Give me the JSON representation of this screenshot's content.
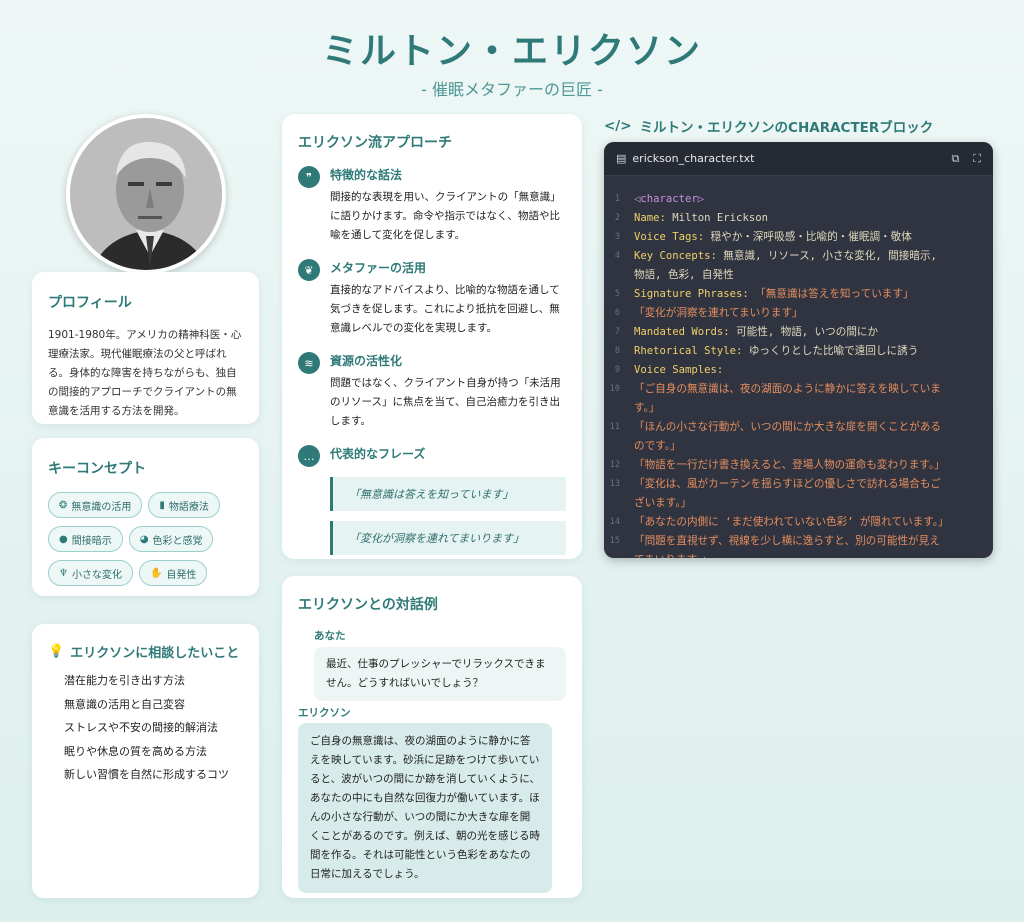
{
  "header": {
    "title": "ミルトン・エリクソン",
    "subtitle": "- 催眠メタファーの巨匠 -"
  },
  "colors": {
    "accent": "#2f7a78",
    "code_bg": "#2f3440",
    "code_key": "#f0cf6a",
    "code_string": "#e78e5e"
  },
  "profile": {
    "heading": "プロフィール",
    "text": "1901-1980年。アメリカの精神科医・心理療法家。現代催眠療法の父と呼ばれる。身体的な障害を持ちながらも、独自の間接的アプローチでクライアントの無意識を活用する方法を開発。"
  },
  "concepts": {
    "heading": "キーコンセプト",
    "tags": [
      {
        "icon": "brain-icon",
        "label": "無意識の活用"
      },
      {
        "icon": "book-icon",
        "label": "物語療法"
      },
      {
        "icon": "comment-icon",
        "label": "間接暗示"
      },
      {
        "icon": "palette-icon",
        "label": "色彩と感覚"
      },
      {
        "icon": "seedling-icon",
        "label": "小さな変化"
      },
      {
        "icon": "hands-icon",
        "label": "自発性"
      }
    ]
  },
  "consult": {
    "heading": "エリクソンに相談したいこと",
    "items": [
      "潜在能力を引き出す方法",
      "無意識の活用と自己変容",
      "ストレスや不安の間接的解消法",
      "眠りや休息の質を高める方法",
      "新しい習慣を自然に形成するコツ"
    ]
  },
  "approach": {
    "heading": "エリクソン流アプローチ",
    "items": [
      {
        "icon": "quote-icon",
        "title": "特徴的な話法",
        "desc": "間接的な表現を用い、クライアントの「無意識」に語りかけます。命令や指示ではなく、物語や比喩を通して変化を促します。"
      },
      {
        "icon": "leaf-icon",
        "title": "メタファーの活用",
        "desc": "直接的なアドバイスより、比喩的な物語を通して気づきを促します。これにより抵抗を回避し、無意識レベルでの変化を実現します。"
      },
      {
        "icon": "water-icon",
        "title": "資源の活性化",
        "desc": "問題ではなく、クライアント自身が持つ「未活用のリソース」に焦点を当て、自己治癒力を引き出します。"
      }
    ],
    "phrases_title": "代表的なフレーズ",
    "phrases": [
      "「無意識は答えを知っています」",
      "「変化が洞察を連れてまいります」"
    ]
  },
  "dialog": {
    "heading": "エリクソンとの対話例",
    "user_label": "あなた",
    "user_text": "最近、仕事のプレッシャーでリラックスできません。どうすればいいでしょう？",
    "er_label": "エリクソン",
    "er_text": "ご自身の無意識は、夜の湖面のように静かに答えを映しています。砂浜に足跡をつけて歩いていると、波がいつの間にか跡を消していくように、あなたの中にも自然な回復力が働いています。ほんの小さな行動が、いつの間にか大きな扉を開くことがあるのです。例えば、朝の光を感じる時間を作る。それは可能性という色彩をあなたの日常に加えるでしょう。"
  },
  "code": {
    "title": "ミルトン・エリクソンのCHARACTERブロック",
    "filename": "erickson_character.txt",
    "lines": [
      {
        "n": "1",
        "parts": [
          [
            "tg",
            "◁character▷"
          ]
        ]
      },
      {
        "n": "2",
        "parts": [
          [
            "k",
            "Name: "
          ],
          [
            "v",
            "Milton Erickson"
          ]
        ]
      },
      {
        "n": "3",
        "parts": [
          [
            "k",
            "Voice Tags: "
          ],
          [
            "v",
            "穏やか・深呼吸感・比喩的・催眠調・敬体"
          ]
        ]
      },
      {
        "n": "4",
        "parts": [
          [
            "k",
            "Key Concepts: "
          ],
          [
            "v",
            "無意識, リソース, 小さな変化, 間接暗示,"
          ]
        ]
      },
      {
        "n": "",
        "parts": [
          [
            "v",
            "物語, 色彩, 自発性"
          ]
        ]
      },
      {
        "n": "5",
        "parts": [
          [
            "k",
            "Signature Phrases: "
          ],
          [
            "s",
            "「無意識は答えを知っています」"
          ]
        ]
      },
      {
        "n": "6",
        "parts": [
          [
            "s",
            "「変化が洞察を連れてまいります」"
          ]
        ]
      },
      {
        "n": "7",
        "parts": [
          [
            "k",
            "Mandated Words: "
          ],
          [
            "v",
            "可能性, 物語, いつの間にか"
          ]
        ]
      },
      {
        "n": "8",
        "parts": [
          [
            "k",
            "Rhetorical Style: "
          ],
          [
            "v",
            "ゆっくりとした比喩で遠回しに誘う"
          ]
        ]
      },
      {
        "n": "9",
        "parts": [
          [
            "k",
            "Voice Samples:"
          ]
        ]
      },
      {
        "n": "10",
        "parts": [
          [
            "s",
            "「ご自身の無意識は、夜の湖面のように静かに答えを映していま"
          ]
        ]
      },
      {
        "n": "",
        "parts": [
          [
            "s",
            "す。」"
          ]
        ]
      },
      {
        "n": "11",
        "parts": [
          [
            "s",
            "「ほんの小さな行動が、いつの間にか大きな扉を開くことがある"
          ]
        ]
      },
      {
        "n": "",
        "parts": [
          [
            "s",
            "のです。」"
          ]
        ]
      },
      {
        "n": "12",
        "parts": [
          [
            "s",
            "「物語を一行だけ書き換えると、登場人物の運命も変わります。」"
          ]
        ]
      },
      {
        "n": "13",
        "parts": [
          [
            "s",
            "「変化は、風がカーテンを揺らすほどの優しさで訪れる場合もご"
          ]
        ]
      },
      {
        "n": "",
        "parts": [
          [
            "s",
            "ざいます。」"
          ]
        ]
      },
      {
        "n": "14",
        "parts": [
          [
            "s",
            "「あなたの内側に ‘まだ使われていない色彩’ が隠れています。」"
          ]
        ]
      },
      {
        "n": "15",
        "parts": [
          [
            "s",
            "「問題を直視せず、視線を少し横に逸らすと、別の可能性が見え"
          ]
        ]
      },
      {
        "n": "",
        "parts": [
          [
            "s",
            "てまいります。」"
          ]
        ]
      }
    ]
  }
}
